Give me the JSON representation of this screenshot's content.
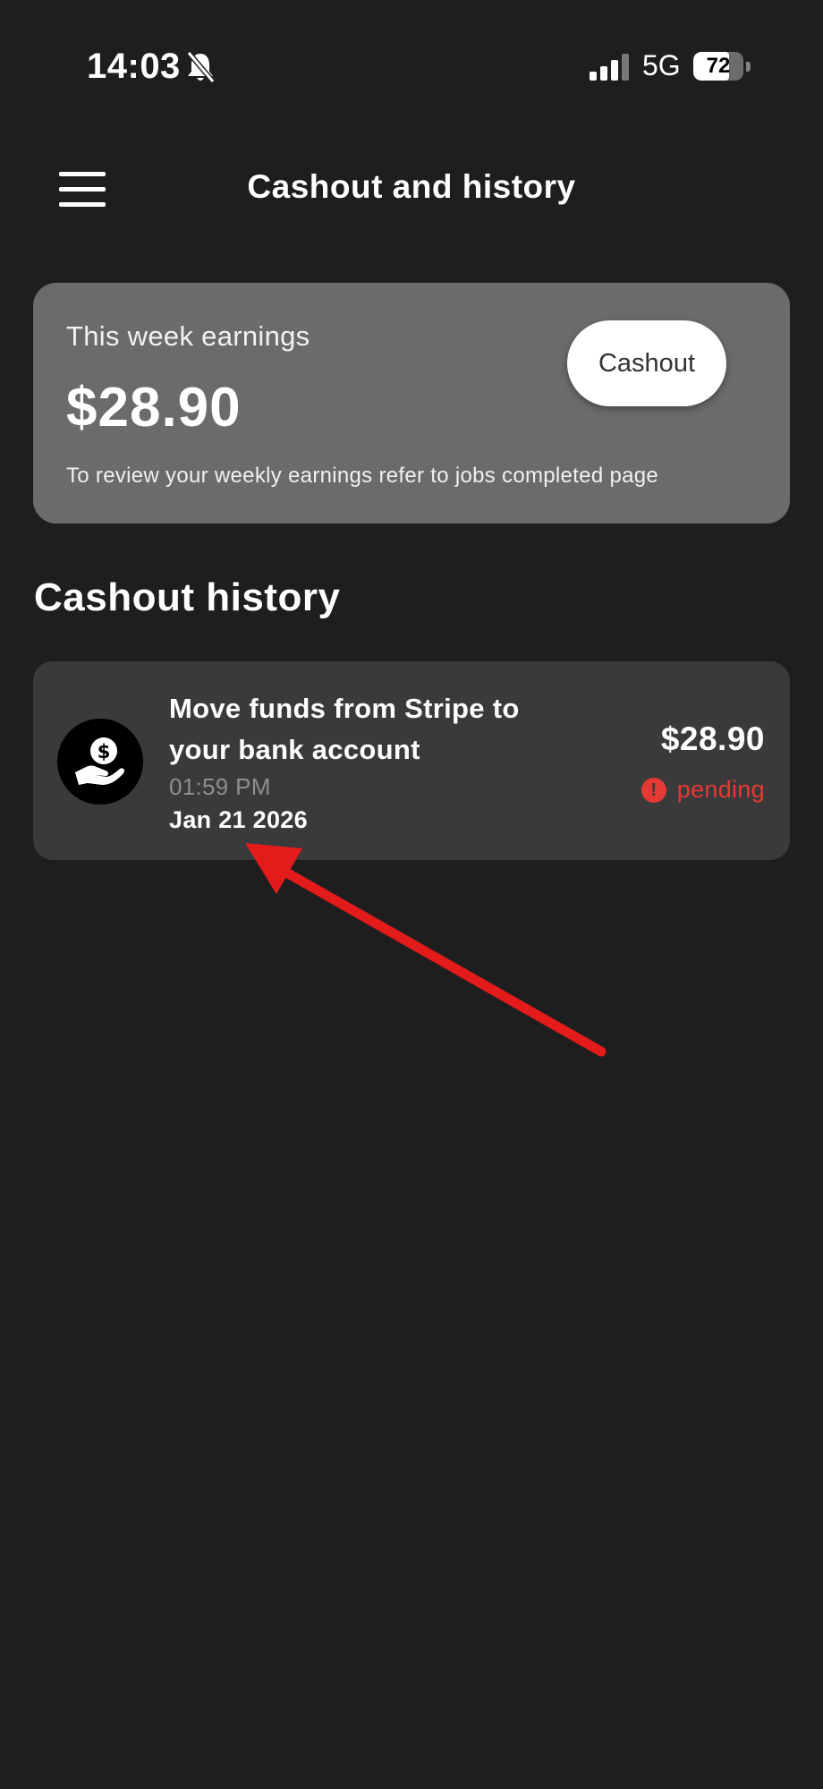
{
  "status_bar": {
    "time": "14:03",
    "network": "5G",
    "battery_level": "72",
    "battery_fraction": 0.72,
    "icons": [
      "bell-muted-icon",
      "signal-icon",
      "battery-icon"
    ]
  },
  "header": {
    "title": "Cashout and history",
    "menu_icon": "menu-icon"
  },
  "earnings_card": {
    "label": "This week earnings",
    "amount": "$28.90",
    "note": "To review your weekly earnings refer to jobs completed page",
    "button_label": "Cashout"
  },
  "history": {
    "title": "Cashout history",
    "items": [
      {
        "icon": "money-hand-icon",
        "title": "Move funds from Stripe to your bank account",
        "time": "01:59 PM",
        "date": "Jan 21 2026",
        "amount": "$28.90",
        "status": "pending",
        "status_icon": "alert-circle-icon"
      }
    ]
  },
  "colors": {
    "background": "#1e1e1e",
    "card": "#6b6b6b",
    "row": "#3a3a3a",
    "pending": "#e53935",
    "annotation": "#e31b1b"
  }
}
